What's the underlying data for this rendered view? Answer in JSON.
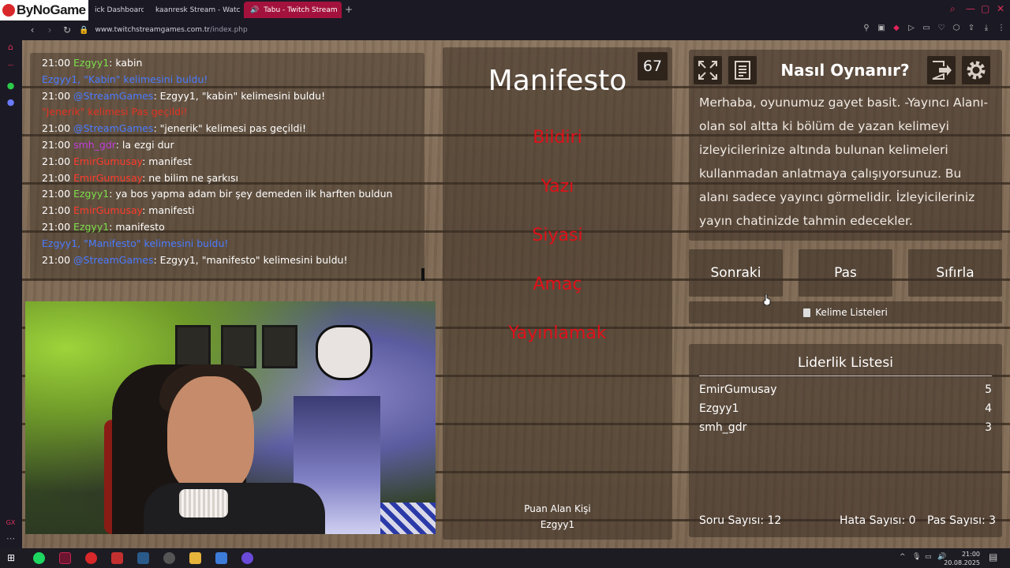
{
  "browser": {
    "logo": "ByNoGame",
    "tabs": [
      {
        "label": "ick Dashboard"
      },
      {
        "label": "kaanresk Stream - Watch"
      },
      {
        "label": "Tabu - Twitch Stream"
      }
    ],
    "new_tab": "+",
    "url_host": "www.twitchstreamgames.com.tr",
    "url_path": "/index.php"
  },
  "chat": {
    "lines": [
      {
        "time": "21:00",
        "user": "Ezgyy1",
        "text": ": kabin"
      },
      {
        "system": "Ezgyy1, \"Kabin\" kelimesini buldu!"
      },
      {
        "time": "21:00",
        "user": "@StreamGames",
        "text": ": Ezgyy1, \"kabin\" kelimesini buldu!"
      },
      {
        "system": "\"Jenerik\" kelimesi Pas geçildi!"
      },
      {
        "time": "21:00",
        "user": "@StreamGames",
        "text": ": \"jenerik\" kelimesi pas geçildi!"
      },
      {
        "time": "21:00",
        "user": "smh_gdr",
        "text": ": la ezgi dur"
      },
      {
        "time": "21:00",
        "user": "EmirGumusay",
        "text": ": manifest"
      },
      {
        "time": "21:00",
        "user": "EmirGumusay",
        "text": ": ne bilim ne şarkısı"
      },
      {
        "time": "21:00",
        "user": "Ezgyy1",
        "text": ": ya bos yapma adam bir şey demeden ilk harften buldun"
      },
      {
        "time": "21:00",
        "user": "EmirGumusay",
        "text": ": manifesti"
      },
      {
        "time": "21:00",
        "user": "Ezgyy1",
        "text": ": manifesto"
      },
      {
        "system": "Ezgyy1, \"Manifesto\" kelimesini buldu!"
      },
      {
        "time": "21:00",
        "user": "@StreamGames",
        "text": ": Ezgyy1, \"manifesto\" kelimesini buldu!"
      }
    ]
  },
  "card": {
    "timer": "67",
    "word": "Manifesto",
    "taboo_words": [
      "Bildiri",
      "Yazı",
      "Siyasi",
      "Amaç",
      "Yayınlamak"
    ],
    "scorer_label": "Puan Alan Kişi",
    "scorer_name": "Ezgyy1"
  },
  "info": {
    "title": "Nasıl Oynanır?",
    "text": "Merhaba, oyunumuz gayet basit. -Yayıncı Alanı- olan sol altta ki bölüm de yazan kelimeyi izleyicilerinize altında bulunan kelimeleri kullanmadan anlatmaya çalışıyorsunuz. Bu alanı sadece yayıncı görmelidir. İzleyicileriniz yayın chatinizde tahmin edecekler."
  },
  "controls": {
    "next": "Sonraki",
    "pass": "Pas",
    "reset": "Sıfırla",
    "word_lists": "Kelime Listeleri"
  },
  "leaderboard": {
    "title": "Liderlik Listesi",
    "rows": [
      {
        "name": "EmirGumusay",
        "score": "5"
      },
      {
        "name": "Ezgyy1",
        "score": "4"
      },
      {
        "name": "smh_gdr",
        "score": "3"
      }
    ],
    "question_count": "Soru Sayısı: 12",
    "error_count": "Hata Sayısı: 0",
    "pass_count": "Pas Sayısı: 3"
  },
  "taskbar": {
    "time": "21:00",
    "date": "20.08.2025"
  },
  "colors": {
    "taboo_red": "#e01019",
    "tab_active": "#a3123c",
    "wood": "#7d6853"
  }
}
